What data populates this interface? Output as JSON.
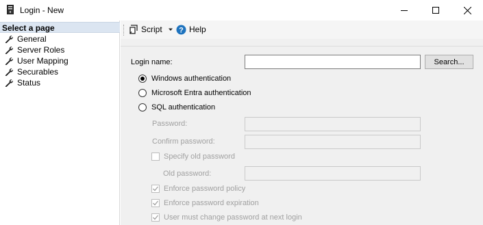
{
  "window": {
    "title": "Login - New",
    "icon": "server-icon",
    "controls": [
      "minimize-icon",
      "maximize-icon",
      "close-icon"
    ]
  },
  "sidebar": {
    "header": "Select a page",
    "items": [
      {
        "label": "General",
        "icon": "wrench-icon"
      },
      {
        "label": "Server Roles",
        "icon": "wrench-icon"
      },
      {
        "label": "User Mapping",
        "icon": "wrench-icon"
      },
      {
        "label": "Securables",
        "icon": "wrench-icon"
      },
      {
        "label": "Status",
        "icon": "wrench-icon"
      }
    ]
  },
  "toolbar": {
    "script_label": "Script",
    "help_label": "Help"
  },
  "form": {
    "login_name_label": "Login name:",
    "login_name_value": "",
    "search_button": "Search...",
    "auth_options": [
      {
        "label": "Windows authentication",
        "checked": true
      },
      {
        "label": "Microsoft Entra authentication",
        "checked": false
      },
      {
        "label": "SQL authentication",
        "checked": false
      }
    ],
    "password_label": "Password:",
    "confirm_password_label": "Confirm password:",
    "specify_old_password_label": "Specify old password",
    "old_password_label": "Old password:",
    "enforce_policy_label": "Enforce password policy",
    "enforce_expiration_label": "Enforce password expiration",
    "must_change_label": "User must change password at next login"
  },
  "colors": {
    "pane_background": "#f0f0f0",
    "header_highlight": "#dbe5f1",
    "help_icon": "#1e73be",
    "disabled_text": "#a0a0a0"
  }
}
